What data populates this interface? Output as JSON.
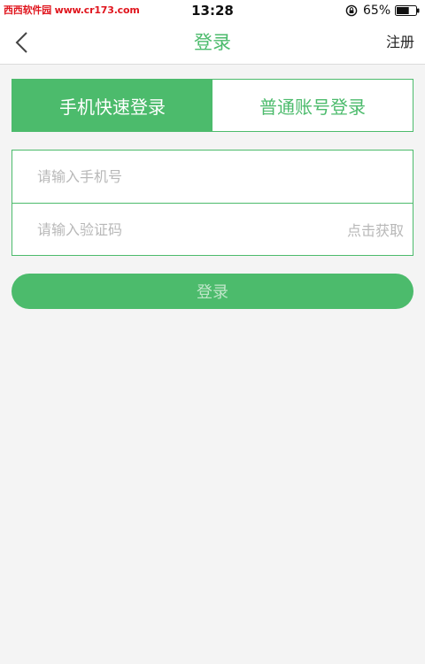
{
  "status_bar": {
    "watermark": "西西软件园 www.cr173.com",
    "time": "13:28",
    "battery_percent": "65%",
    "battery_level": 0.65
  },
  "nav": {
    "title": "登录",
    "register": "注册"
  },
  "tabs": [
    {
      "label": "手机快速登录",
      "active": true
    },
    {
      "label": "普通账号登录",
      "active": false
    }
  ],
  "form": {
    "phone_placeholder": "请输入手机号",
    "code_placeholder": "请输入验证码",
    "get_code": "点击获取"
  },
  "login_button": "登录",
  "colors": {
    "accent": "#4cbb6c",
    "background": "#f4f4f4",
    "watermark": "#e0161e",
    "placeholder": "#b8b8b8"
  }
}
